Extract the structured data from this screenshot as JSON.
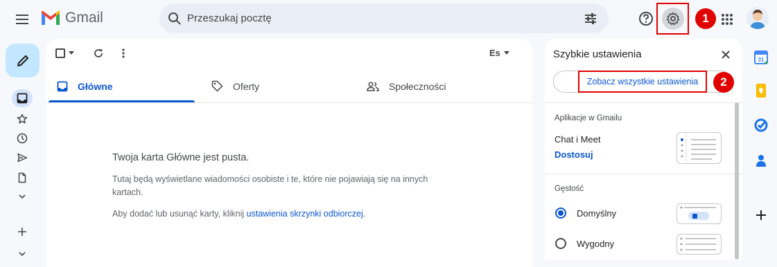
{
  "header": {
    "app_name": "Gmail",
    "search_placeholder": "Przeszukaj pocztę"
  },
  "annotations": {
    "badge1": "1",
    "badge2": "2"
  },
  "toolbar": {
    "sort_label": "Es"
  },
  "tabs": [
    {
      "label": "Główne"
    },
    {
      "label": "Oferty"
    },
    {
      "label": "Społeczności"
    }
  ],
  "empty_state": {
    "title": "Twoja karta Główne jest pusta.",
    "line1": "Tutaj będą wyświetlane wiadomości osobiste i te, które nie pojawiają się na innych kartach.",
    "line2_prefix": "Aby dodać lub usunąć karty, kliknij",
    "line2_link": "ustawienia skrzynki odbiorczej",
    "line2_suffix": "."
  },
  "quick_settings": {
    "title": "Szybkie ustawienia",
    "see_all": "Zobacz wszystkie ustawienia",
    "apps_section": "Aplikacje w Gmailu",
    "chat_meet": "Chat i Meet",
    "customize": "Dostosuj",
    "density_section": "Gęstość",
    "density_options": [
      {
        "label": "Domyślny",
        "selected": true
      },
      {
        "label": "Wygodny",
        "selected": false
      }
    ]
  },
  "colors": {
    "accent": "#0b57d0",
    "highlight": "#e00000"
  }
}
